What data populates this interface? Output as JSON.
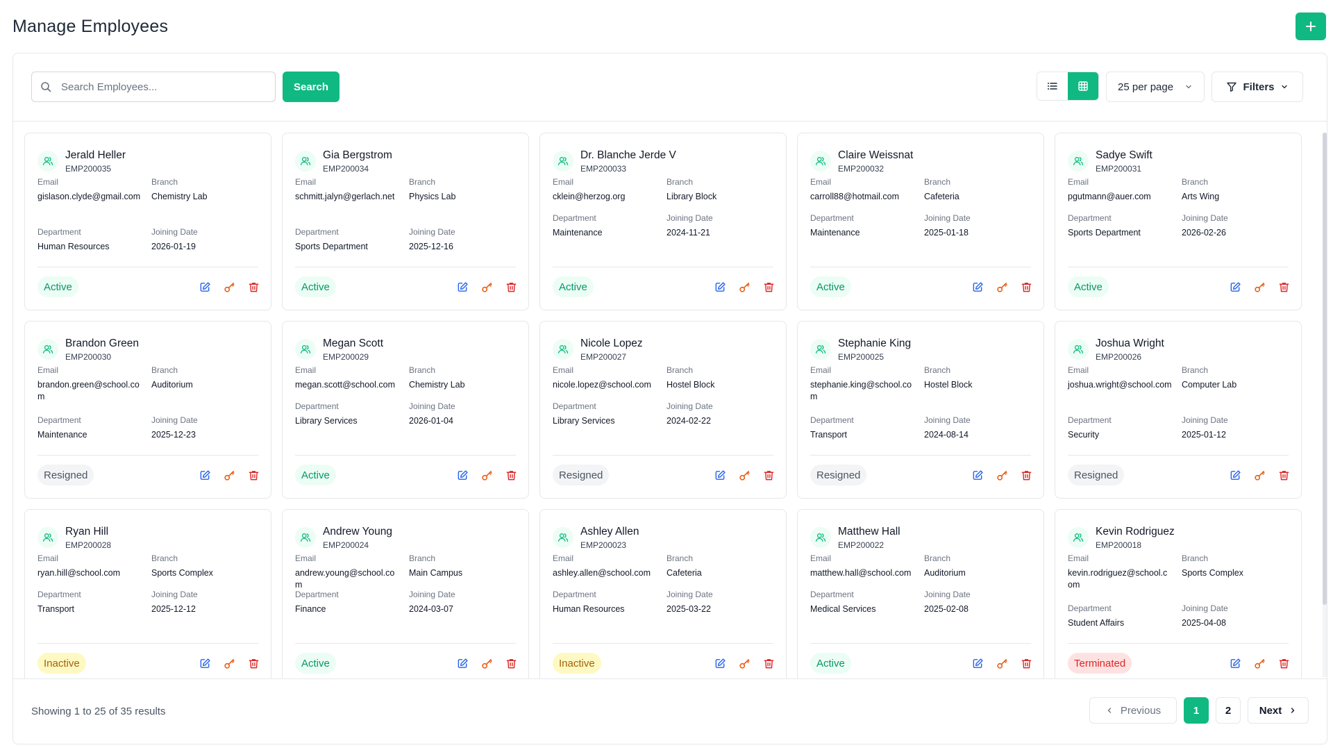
{
  "header": {
    "title": "Manage Employees",
    "add_icon": "plus-icon"
  },
  "toolbar": {
    "search_placeholder": "Search Employees...",
    "search_value": "",
    "search_label": "Search",
    "view_modes": [
      "list",
      "grid"
    ],
    "active_view": "grid",
    "per_page": "25 per page",
    "filters_label": "Filters"
  },
  "labels": {
    "email": "Email",
    "branch": "Branch",
    "department": "Department",
    "joining_date": "Joining Date"
  },
  "employees": [
    {
      "name": "Jerald Heller",
      "id": "EMP200035",
      "email": "gislason.clyde@gmail.com",
      "branch": "Chemistry Lab",
      "department": "Human Resources",
      "joining_date": "2026-01-19",
      "status": "Active"
    },
    {
      "name": "Gia Bergstrom",
      "id": "EMP200034",
      "email": "schmitt.jalyn@gerlach.net",
      "branch": "Physics Lab",
      "department": "Sports Department",
      "joining_date": "2025-12-16",
      "status": "Active"
    },
    {
      "name": "Dr. Blanche Jerde V",
      "id": "EMP200033",
      "email": "cklein@herzog.org",
      "branch": "Library Block",
      "department": "Maintenance",
      "joining_date": "2024-11-21",
      "status": "Active"
    },
    {
      "name": "Claire Weissnat",
      "id": "EMP200032",
      "email": "carroll88@hotmail.com",
      "branch": "Cafeteria",
      "department": "Maintenance",
      "joining_date": "2025-01-18",
      "status": "Active"
    },
    {
      "name": "Sadye Swift",
      "id": "EMP200031",
      "email": "pgutmann@auer.com",
      "branch": "Arts Wing",
      "department": "Sports Department",
      "joining_date": "2026-02-26",
      "status": "Active"
    },
    {
      "name": "Brandon Green",
      "id": "EMP200030",
      "email": "brandon.green@school.com",
      "branch": "Auditorium",
      "department": "Maintenance",
      "joining_date": "2025-12-23",
      "status": "Resigned"
    },
    {
      "name": "Megan Scott",
      "id": "EMP200029",
      "email": "megan.scott@school.com",
      "branch": "Chemistry Lab",
      "department": "Library Services",
      "joining_date": "2026-01-04",
      "status": "Active"
    },
    {
      "name": "Nicole Lopez",
      "id": "EMP200027",
      "email": "nicole.lopez@school.com",
      "branch": "Hostel Block",
      "department": "Library Services",
      "joining_date": "2024-02-22",
      "status": "Resigned"
    },
    {
      "name": "Stephanie King",
      "id": "EMP200025",
      "email": "stephanie.king@school.com",
      "branch": "Hostel Block",
      "department": "Transport",
      "joining_date": "2024-08-14",
      "status": "Resigned"
    },
    {
      "name": "Joshua Wright",
      "id": "EMP200026",
      "email": "joshua.wright@school.com",
      "branch": "Computer Lab",
      "department": "Security",
      "joining_date": "2025-01-12",
      "status": "Resigned"
    },
    {
      "name": "Ryan Hill",
      "id": "EMP200028",
      "email": "ryan.hill@school.com",
      "branch": "Sports Complex",
      "department": "Transport",
      "joining_date": "2025-12-12",
      "status": "Inactive"
    },
    {
      "name": "Andrew Young",
      "id": "EMP200024",
      "email": "andrew.young@school.com",
      "branch": "Main Campus",
      "department": "Finance",
      "joining_date": "2024-03-07",
      "status": "Active"
    },
    {
      "name": "Ashley Allen",
      "id": "EMP200023",
      "email": "ashley.allen@school.com",
      "branch": "Cafeteria",
      "department": "Human Resources",
      "joining_date": "2025-03-22",
      "status": "Inactive"
    },
    {
      "name": "Matthew Hall",
      "id": "EMP200022",
      "email": "matthew.hall@school.com",
      "branch": "Auditorium",
      "department": "Medical Services",
      "joining_date": "2025-02-08",
      "status": "Active"
    },
    {
      "name": "Kevin Rodriguez",
      "id": "EMP200018",
      "email": "kevin.rodriguez@school.com",
      "branch": "Sports Complex",
      "department": "Student Affairs",
      "joining_date": "2025-04-08",
      "status": "Terminated"
    }
  ],
  "status_colors": {
    "Active": "#059669",
    "Resigned": "#4b5563",
    "Inactive": "#a16207",
    "Terminated": "#dc2626"
  },
  "accent_color": "#10b981",
  "card_actions": [
    "edit-icon",
    "key-icon",
    "trash-icon"
  ],
  "footer": {
    "results_text": "Showing 1 to 25 of 35 results",
    "previous_label": "Previous",
    "pages": [
      "1",
      "2"
    ],
    "current_page": "1",
    "next_label": "Next"
  }
}
